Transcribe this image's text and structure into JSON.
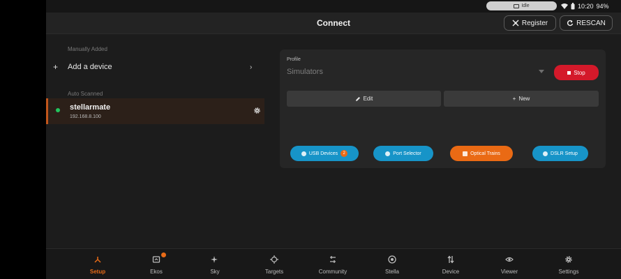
{
  "status_bar": {
    "pill_label": "Idle",
    "battery": "94%",
    "time": "10:20"
  },
  "header": {
    "title": "Connect",
    "register_label": "Register",
    "rescan_label": "RESCAN"
  },
  "device_list": {
    "manual_section_label": "Manually Added",
    "add_device_label": "Add a device",
    "auto_section_label": "Auto Scanned",
    "device": {
      "name": "stellarmate",
      "ip": "192.168.8.100",
      "status_color": "#22c55e"
    }
  },
  "profile_panel": {
    "profile_label": "Profile",
    "profile_value": "Simulators",
    "stop_label": "Stop",
    "edit_label": "Edit",
    "new_label": "New",
    "usb_devices_label": "USB Devices",
    "usb_devices_count": "2",
    "port_selector_label": "Port Selector",
    "optical_trains_label": "Optical Trains",
    "dslr_setup_label": "DSLR Setup"
  },
  "bottom_nav": {
    "setup": "Setup",
    "ekos": "Ekos",
    "sky": "Sky",
    "targets": "Targets",
    "community": "Community",
    "stella": "Stella",
    "device": "Device",
    "viewer": "Viewer",
    "settings": "Settings"
  },
  "colors": {
    "accent": "#e86b17",
    "danger": "#d4192a",
    "info": "#1794c8"
  }
}
